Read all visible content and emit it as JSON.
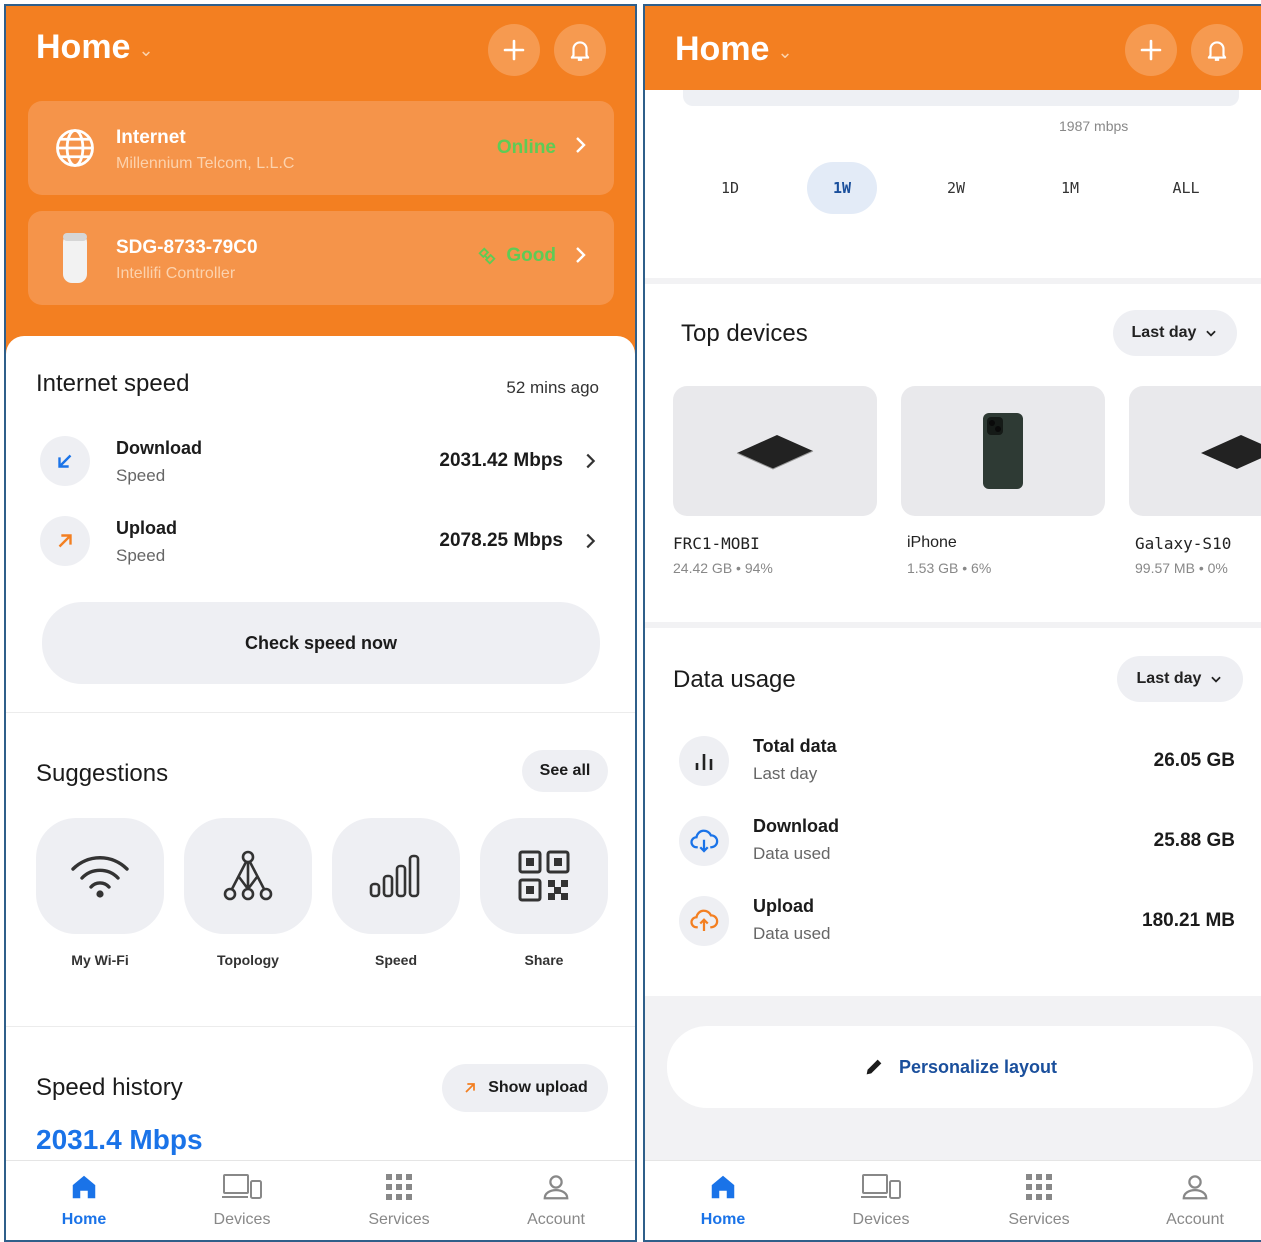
{
  "left": {
    "header": {
      "title": "Home"
    },
    "internet_card": {
      "name": "Internet",
      "provider": "Millennium Telcom, L.L.C",
      "status": "Online"
    },
    "router_card": {
      "name": "SDG-8733-79C0",
      "model": "Intellifi Controller",
      "status": "Good"
    },
    "internet_speed": {
      "title": "Internet speed",
      "updated": "52 mins ago",
      "download": {
        "label": "Download",
        "sub": "Speed",
        "value": "2031.42 Mbps"
      },
      "upload": {
        "label": "Upload",
        "sub": "Speed",
        "value": "2078.25 Mbps"
      },
      "check_button": "Check speed now"
    },
    "suggestions": {
      "title": "Suggestions",
      "see_all": "See all",
      "items": [
        {
          "label": "My Wi-Fi",
          "icon": "wifi-icon"
        },
        {
          "label": "Topology",
          "icon": "topology-icon"
        },
        {
          "label": "Speed",
          "icon": "signal-bars-icon"
        },
        {
          "label": "Share",
          "icon": "qr-code-icon"
        }
      ]
    },
    "speed_history": {
      "title": "Speed history",
      "toggle": "Show upload",
      "value": "2031.4 Mbps"
    }
  },
  "right": {
    "header": {
      "title": "Home"
    },
    "chart_peak": "1987 mbps",
    "ranges": [
      "1D",
      "1W",
      "2W",
      "1M",
      "ALL"
    ],
    "selected_range": "1W",
    "top_devices": {
      "title": "Top devices",
      "filter": "Last day",
      "devices": [
        {
          "name": "FRC1-MOBI",
          "usage": "24.42 GB • 94%"
        },
        {
          "name": "iPhone",
          "usage": "1.53 GB • 6%"
        },
        {
          "name": "Galaxy-S10",
          "usage": "99.57 MB • 0%"
        }
      ]
    },
    "data_usage": {
      "title": "Data usage",
      "filter": "Last day",
      "total": {
        "label": "Total data",
        "sub": "Last day",
        "value": "26.05 GB"
      },
      "download": {
        "label": "Download",
        "sub": "Data used",
        "value": "25.88 GB"
      },
      "upload": {
        "label": "Upload",
        "sub": "Data used",
        "value": "180.21 MB"
      }
    },
    "personalize": "Personalize layout"
  },
  "tabs": [
    "Home",
    "Devices",
    "Services",
    "Account"
  ],
  "colors": {
    "brand": "#f37f21",
    "accent": "#1a73e8",
    "good": "#5ecb55"
  }
}
